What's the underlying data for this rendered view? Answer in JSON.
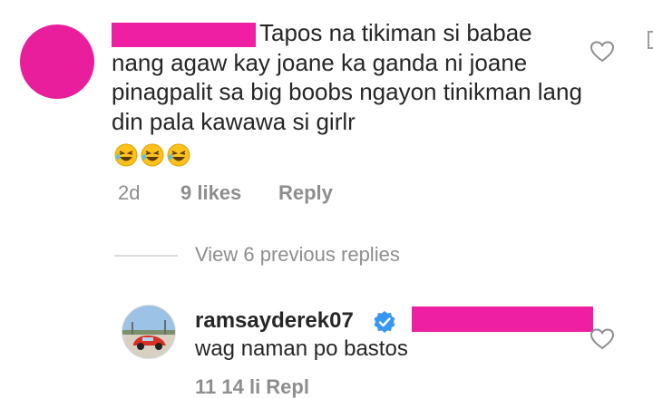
{
  "comment": {
    "text": "Tapos na tikiman si babae nang agaw kay joane ka ganda ni joane pinagpalit sa big boobs ngayon tinikman lang din pala kawawa si girlr",
    "emoji_glyph": "🤣",
    "emoji_count": 3,
    "time": "2d",
    "likes": "9 likes",
    "reply_label": "Reply"
  },
  "view_replies_label": "View 6 previous replies",
  "reply": {
    "username": "ramsayderek07",
    "text": "wag naman po bastos",
    "meta_partial": "11      14 li       Repl"
  },
  "colors": {
    "redaction": "#ee1fa3",
    "verified": "#3897f0",
    "muted_text": "#8e8e8e",
    "main_text": "#262626"
  },
  "icons": [
    "heart-outline-icon",
    "verified-badge-icon",
    "laughing-emoji-icon"
  ]
}
